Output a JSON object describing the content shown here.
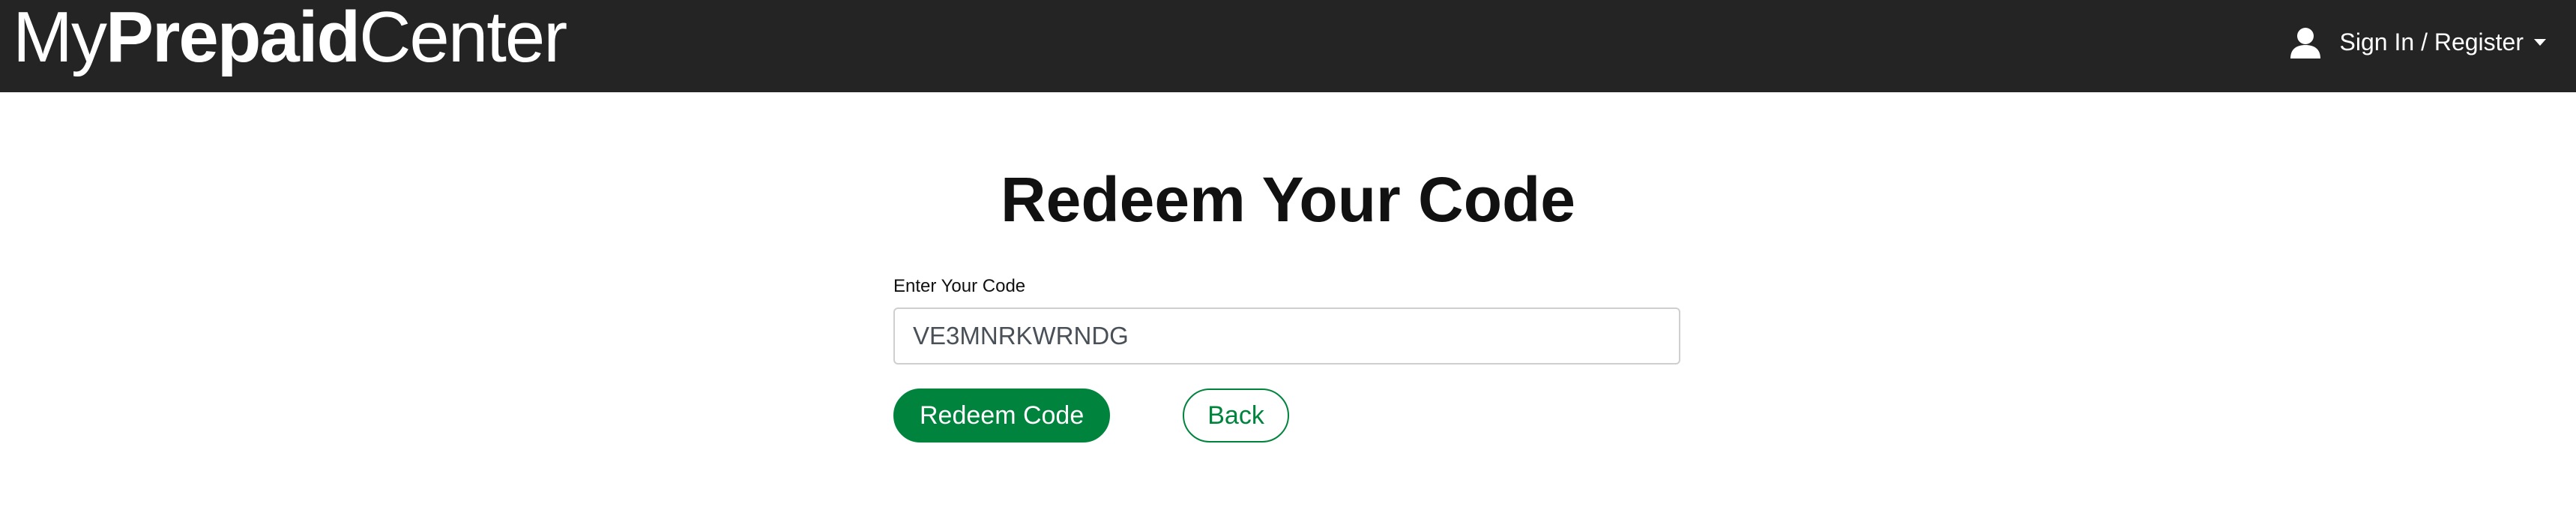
{
  "header": {
    "brand": {
      "part1": "My",
      "part2": "Prepaid",
      "part3": "Center"
    },
    "account": {
      "icon": "user-icon",
      "label": "Sign In / Register"
    }
  },
  "main": {
    "title": "Redeem Your Code",
    "code_field": {
      "label": "Enter Your Code",
      "value": "VE3MNRKWRNDG"
    },
    "redeem_button_label": "Redeem Code",
    "back_button_label": "Back"
  },
  "colors": {
    "navbar": "#242424",
    "accent_green": "#00843d",
    "page_background": "#ffffff"
  }
}
